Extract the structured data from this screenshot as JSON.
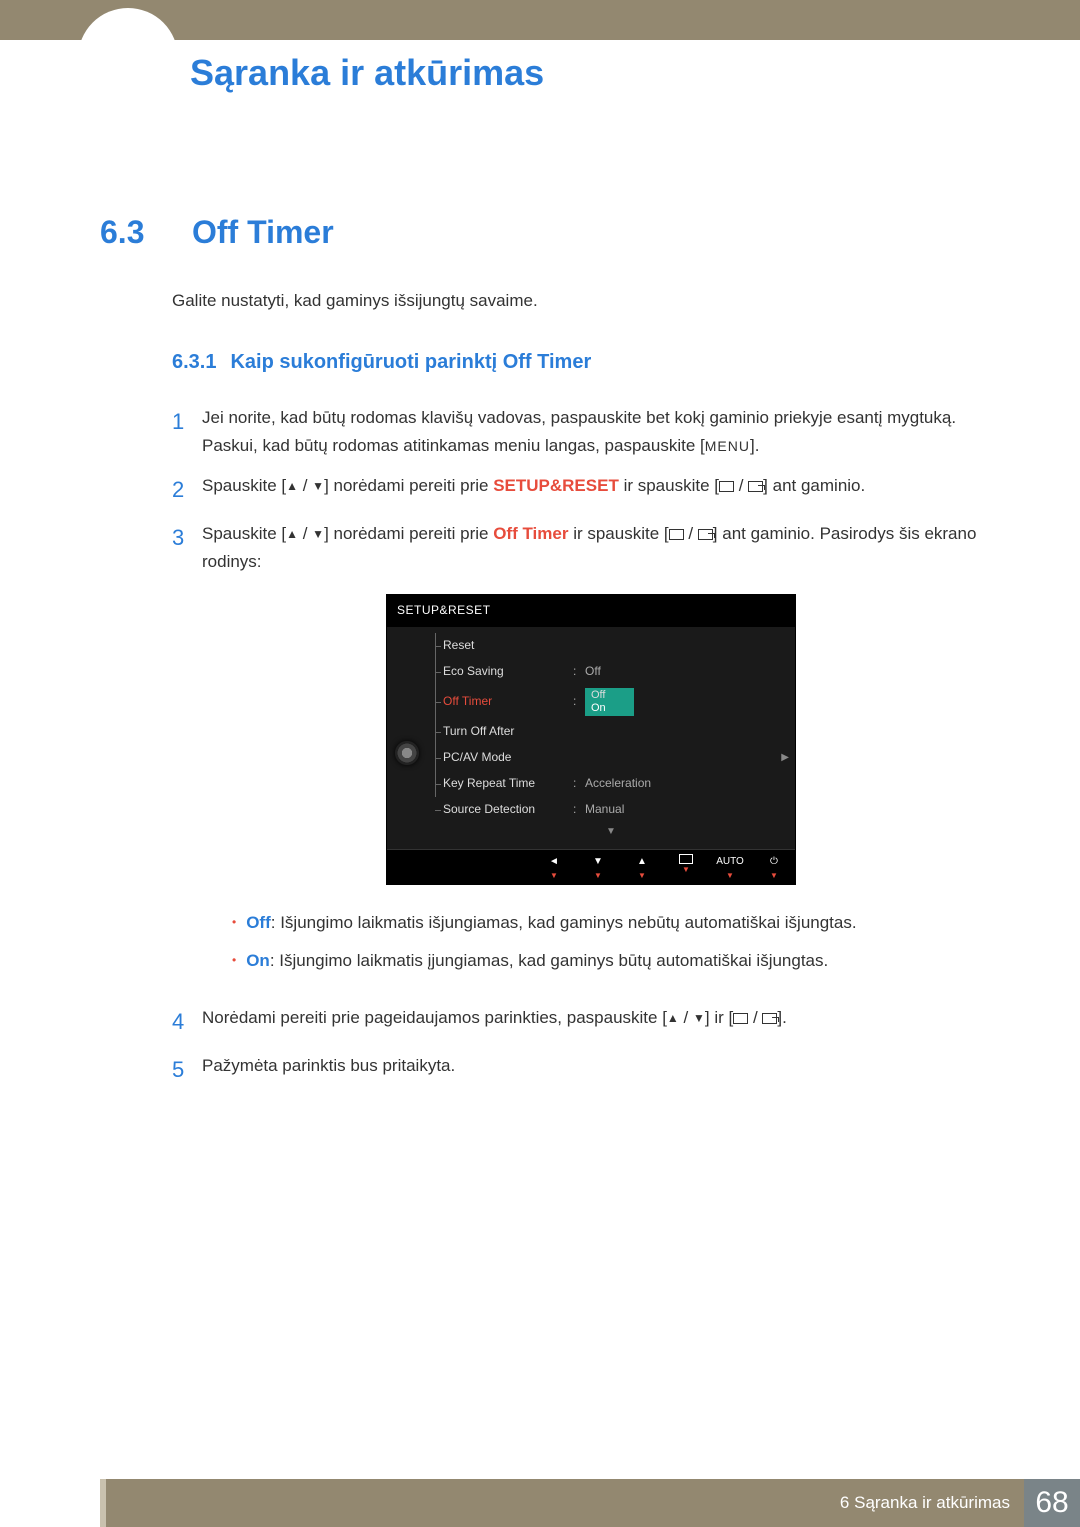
{
  "header": {
    "title": "Sąranka ir atkūrimas"
  },
  "section": {
    "number": "6.3",
    "title": "Off Timer",
    "intro": "Galite nustatyti, kad gaminys išsijungtų savaime."
  },
  "subsection": {
    "number": "6.3.1",
    "title": "Kaip sukonfigūruoti parinktį Off Timer"
  },
  "steps": {
    "s1": {
      "num": "1",
      "text_a": "Jei norite, kad būtų rodomas klavišų vadovas, paspauskite bet kokį gaminio priekyje esantį mygtuką. Paskui, kad būtų rodomas atitinkamas meniu langas, paspauskite [",
      "menu": "MENU",
      "text_b": "]."
    },
    "s2": {
      "num": "2",
      "text_a": "Spauskite [",
      "text_b": "] norėdami pereiti prie ",
      "hl": "SETUP&RESET",
      "text_c": " ir spauskite [",
      "text_d": "] ant gaminio."
    },
    "s3": {
      "num": "3",
      "text_a": "Spauskite [",
      "text_b": "] norėdami pereiti prie ",
      "hl": "Off Timer",
      "text_c": " ir spauskite [",
      "text_d": "] ant gaminio. Pasirodys šis ekrano rodinys:"
    },
    "s4": {
      "num": "4",
      "text_a": "Norėdami pereiti prie pageidaujamos parinkties, paspauskite [",
      "text_b": "] ir [",
      "text_c": "]."
    },
    "s5": {
      "num": "5",
      "text": "Pažymėta parinktis bus pritaikyta."
    }
  },
  "bullets": {
    "off": {
      "label": "Off",
      "text": ": Išjungimo laikmatis išjungiamas, kad gaminys nebūtų automatiškai išjungtas."
    },
    "on": {
      "label": "On",
      "text": ": Išjungimo laikmatis įjungiamas, kad gaminys būtų automatiškai išjungtas."
    }
  },
  "osd": {
    "title": "SETUP&RESET",
    "items": {
      "reset": "Reset",
      "eco": "Eco Saving",
      "eco_val": "Off",
      "off_timer": "Off Timer",
      "dropdown_off": "Off",
      "dropdown_on": "On",
      "turn_off": "Turn Off After",
      "pcav": "PC/AV Mode",
      "key_repeat": "Key Repeat Time",
      "key_repeat_val": "Acceleration",
      "source": "Source Detection",
      "source_val": "Manual"
    },
    "footer": {
      "auto": "AUTO"
    }
  },
  "footer": {
    "chapter": "6 Sąranka ir atkūrimas",
    "page": "68"
  }
}
